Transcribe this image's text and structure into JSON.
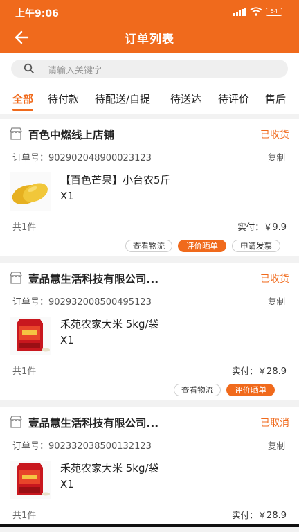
{
  "status_bar": {
    "time": "上午9:06",
    "battery": "54"
  },
  "header": {
    "title": "订单列表",
    "back_icon": "back-arrow-icon"
  },
  "search": {
    "placeholder": "请输入关键字"
  },
  "tabs": [
    {
      "label": "全部",
      "active": true
    },
    {
      "label": "待付款"
    },
    {
      "label": "待配送/自提"
    },
    {
      "label": "待送达"
    },
    {
      "label": "待评价"
    },
    {
      "label": "售后"
    }
  ],
  "orders": [
    {
      "shop": "百色中燃线上店铺",
      "status": "已收货",
      "order_label": "订单号：902902048900023123",
      "copy": "复制",
      "product": "【百色芒果】小台农5斤",
      "qty": "X1",
      "count": "共1件",
      "paid_label": "实付：￥",
      "paid_amount": "9.9",
      "buttons": [
        "查看物流",
        "评价晒单",
        "申请发票"
      ]
    },
    {
      "shop": "壹品慧生活科技有限公司...",
      "status": "已收货",
      "order_label": "订单号：902932008500495123",
      "copy": "复制",
      "product": "禾苑农家大米 5kg/袋",
      "qty": "X1",
      "count": "共1件",
      "paid_label": "实付：￥",
      "paid_amount": "28.9",
      "buttons": [
        "查看物流",
        "评价晒单"
      ]
    },
    {
      "shop": "壹品慧生活科技有限公司...",
      "status": "已取消",
      "order_label": "订单号：902332038500132123",
      "copy": "复制",
      "product": "禾苑农家大米 5kg/袋",
      "qty": "X1",
      "count": "共1件",
      "paid_label": "实付：￥",
      "paid_amount": "28.9"
    }
  ],
  "colors": {
    "accent": "#f06a1c",
    "background": "#f2f2f2"
  }
}
